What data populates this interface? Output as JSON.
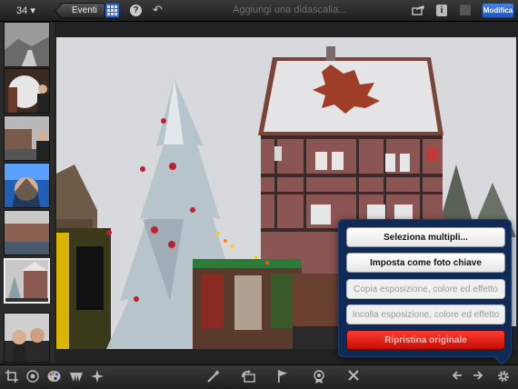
{
  "topbar": {
    "count": "34",
    "back_label": "Eventi",
    "caption_placeholder": "Aggiungi una didascalia...",
    "edit_label": "Modifica"
  },
  "popover": {
    "select_multiple": "Seleziona multipli...",
    "set_key_photo": "Imposta come foto chiave",
    "copy_exposure": "Copia esposizione, colore ed effetto",
    "paste_exposure": "Incolla esposizione, colore ed effetto",
    "revert_original": "Ripristina originale"
  },
  "icons": {
    "crop": "crop-icon",
    "straighten": "straighten-icon",
    "color": "palette-icon",
    "brushes": "brushes-icon",
    "effects": "effects-icon",
    "auto_enhance": "magic-wand-icon",
    "rotate": "rotate-icon",
    "flag": "flag-icon",
    "favorite": "favorite-icon",
    "hide": "hide-icon",
    "prev": "arrow-left-icon",
    "next": "arrow-right-icon",
    "settings": "gear-icon"
  },
  "colors": {
    "accent_blue": "#2e6bd8",
    "popover_bg": "#0f2a54",
    "revert_red": "#e0241a"
  },
  "thumbnails": [
    "winter-road",
    "market-woman",
    "canal-houses-man",
    "woman-portrait",
    "canal-town",
    "roof-tree",
    "couple-selfie"
  ],
  "selected_thumbnail": 5
}
